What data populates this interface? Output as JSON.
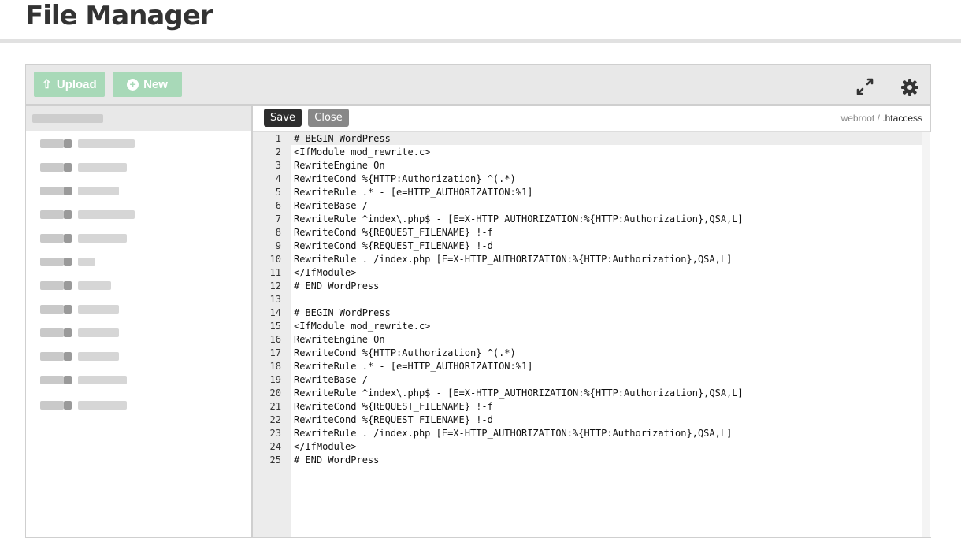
{
  "page": {
    "title": "File Manager"
  },
  "toolbar": {
    "upload_label": "Upload",
    "new_label": "New"
  },
  "editor": {
    "save_label": "Save",
    "close_label": "Close",
    "breadcrumb": {
      "root": "webroot",
      "separator": " / ",
      "file": ".htaccess"
    },
    "lines": [
      {
        "n": "1",
        "text": "# BEGIN WordPress"
      },
      {
        "n": "2",
        "text": "<IfModule mod_rewrite.c>"
      },
      {
        "n": "3",
        "text": "RewriteEngine On"
      },
      {
        "n": "4",
        "text": "RewriteCond %{HTTP:Authorization} ^(.*)"
      },
      {
        "n": "5",
        "text": "RewriteRule .* - [e=HTTP_AUTHORIZATION:%1]"
      },
      {
        "n": "6",
        "text": "RewriteBase /"
      },
      {
        "n": "7",
        "text": "RewriteRule ^index\\.php$ - [E=X-HTTP_AUTHORIZATION:%{HTTP:Authorization},QSA,L]"
      },
      {
        "n": "8",
        "text": "RewriteCond %{REQUEST_FILENAME} !-f"
      },
      {
        "n": "9",
        "text": "RewriteCond %{REQUEST_FILENAME} !-d"
      },
      {
        "n": "10",
        "text": "RewriteRule . /index.php [E=X-HTTP_AUTHORIZATION:%{HTTP:Authorization},QSA,L]"
      },
      {
        "n": "11",
        "text": "</IfModule>"
      },
      {
        "n": "12",
        "text": "# END WordPress"
      },
      {
        "n": "13",
        "text": ""
      },
      {
        "n": "14",
        "text": "# BEGIN WordPress"
      },
      {
        "n": "15",
        "text": "<IfModule mod_rewrite.c>"
      },
      {
        "n": "16",
        "text": "RewriteEngine On"
      },
      {
        "n": "17",
        "text": "RewriteCond %{HTTP:Authorization} ^(.*)"
      },
      {
        "n": "18",
        "text": "RewriteRule .* - [e=HTTP_AUTHORIZATION:%1]"
      },
      {
        "n": "19",
        "text": "RewriteBase /"
      },
      {
        "n": "20",
        "text": "RewriteRule ^index\\.php$ - [E=X-HTTP_AUTHORIZATION:%{HTTP:Authorization},QSA,L]"
      },
      {
        "n": "21",
        "text": "RewriteCond %{REQUEST_FILENAME} !-f"
      },
      {
        "n": "22",
        "text": "RewriteCond %{REQUEST_FILENAME} !-d"
      },
      {
        "n": "23",
        "text": "RewriteRule . /index.php [E=X-HTTP_AUTHORIZATION:%{HTTP:Authorization},QSA,L]"
      },
      {
        "n": "24",
        "text": "</IfModule>"
      },
      {
        "n": "25",
        "text": "# END WordPress"
      }
    ]
  },
  "icons": {
    "upload": "upload-arrow-icon",
    "new": "plus-circle-icon",
    "fullscreen": "expand-arrows-icon",
    "settings": "gear-icon"
  },
  "colors": {
    "accent_green_disabled": "#a8d9b8",
    "save_button": "#2d2d2d",
    "close_button": "#888888",
    "toolbar_bg": "#e8e8e8"
  }
}
